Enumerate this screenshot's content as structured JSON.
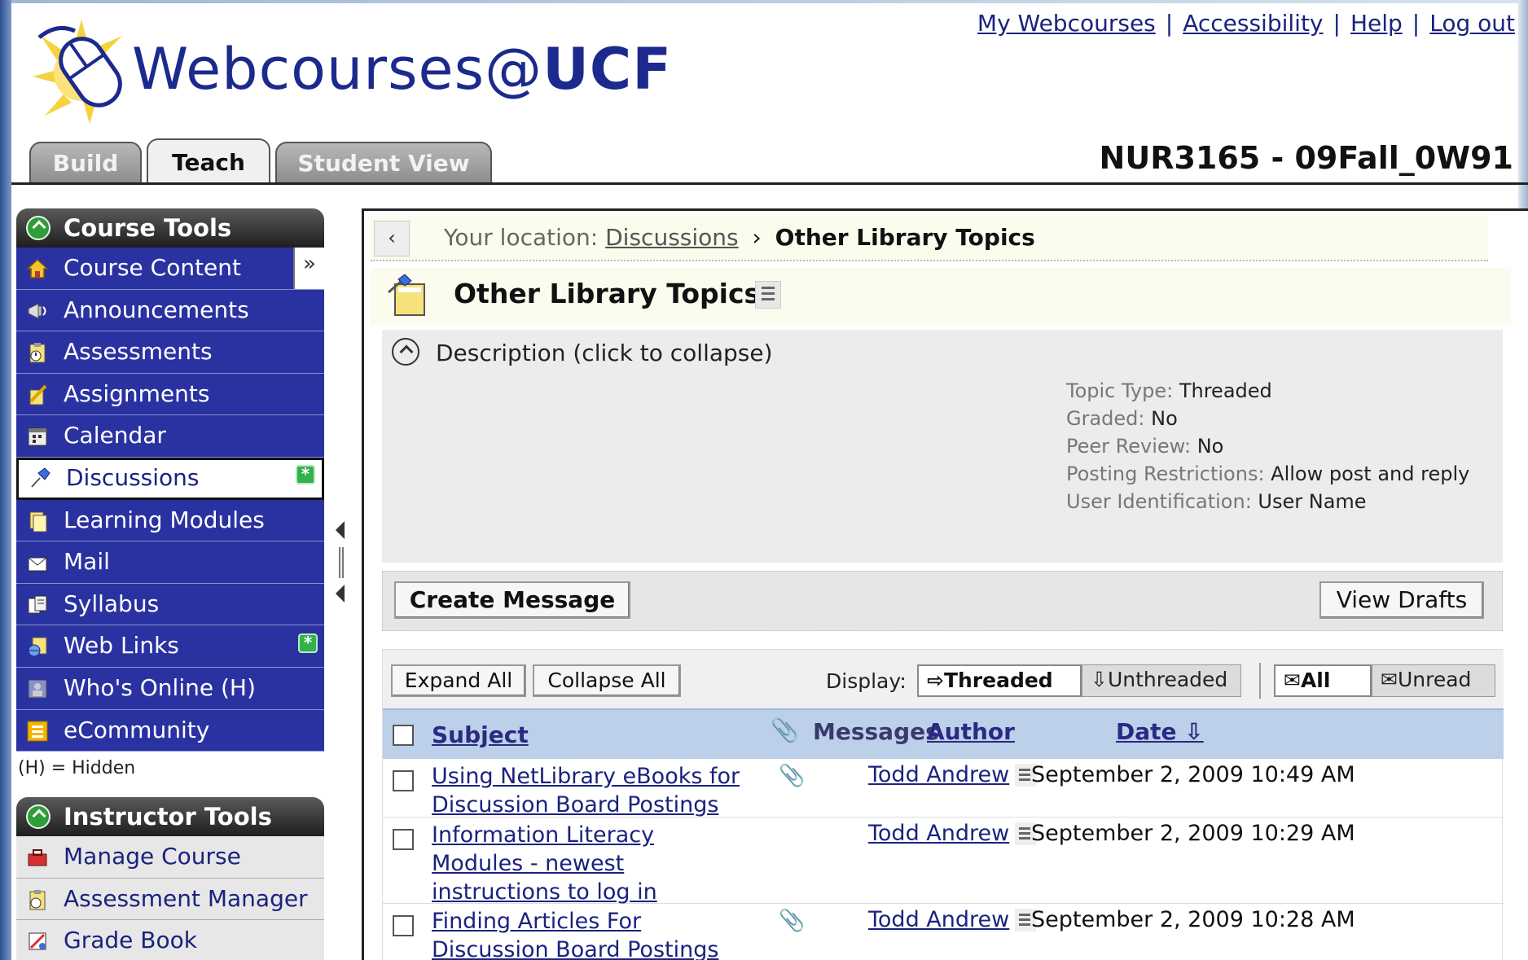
{
  "top_links": [
    "My Webcourses",
    "Accessibility",
    "Help",
    "Log out"
  ],
  "top_links_separator": "|",
  "logo": {
    "text_regular": "Webcourses@",
    "text_bold": "UCF"
  },
  "tabs": [
    {
      "label": "Build",
      "active": false
    },
    {
      "label": "Teach",
      "active": true
    },
    {
      "label": "Student View",
      "active": false
    }
  ],
  "course_id": "NUR3165 - 09Fall_0W91",
  "sidebar": {
    "course_tools_title": "Course Tools",
    "course_tools": [
      {
        "label": "Course Content",
        "icon": "home-icon"
      },
      {
        "label": "Announcements",
        "icon": "megaphone-icon"
      },
      {
        "label": "Assessments",
        "icon": "clipboard-icon"
      },
      {
        "label": "Assignments",
        "icon": "pencil-paper-icon"
      },
      {
        "label": "Calendar",
        "icon": "calendar-icon"
      },
      {
        "label": "Discussions",
        "icon": "pushpin-icon",
        "active": true
      },
      {
        "label": "Learning Modules",
        "icon": "modules-icon"
      },
      {
        "label": "Mail",
        "icon": "mail-icon"
      },
      {
        "label": "Syllabus",
        "icon": "syllabus-icon"
      },
      {
        "label": "Web Links",
        "icon": "globe-icon"
      },
      {
        "label": "Who's Online (H)",
        "icon": "person-icon"
      },
      {
        "label": "eCommunity",
        "icon": "ecommunity-icon"
      }
    ],
    "hidden_note": "(H) = Hidden",
    "badge_glyph": "*",
    "instructor_tools_title": "Instructor Tools",
    "instructor_tools": [
      {
        "label": "Manage Course",
        "icon": "toolbox-icon"
      },
      {
        "label": "Assessment Manager",
        "icon": "clipboard-icon"
      },
      {
        "label": "Grade Book",
        "icon": "gradebook-icon"
      }
    ]
  },
  "breadcrumb": {
    "back_glyph": "‹",
    "prefix": "Your location:",
    "parent": "Discussions",
    "separator": "›",
    "current": "Other Library Topics"
  },
  "page_title": "Other Library Topics",
  "description": {
    "toggle_label": "Description (click to collapse)",
    "meta": [
      {
        "key": "Topic Type:",
        "value": "Threaded"
      },
      {
        "key": "Graded:",
        "value": "No"
      },
      {
        "key": "Peer Review:",
        "value": "No"
      },
      {
        "key": "Posting Restrictions:",
        "value": "Allow post and reply"
      },
      {
        "key": "User Identification:",
        "value": "User Name"
      }
    ]
  },
  "actions": {
    "create_message": "Create Message",
    "view_drafts": "View Drafts"
  },
  "toolbar": {
    "expand_all": "Expand All",
    "collapse_all": "Collapse All",
    "display_label": "Display:",
    "threaded": "⇨Threaded",
    "unthreaded": "⇩Unthreaded",
    "all": "✉All",
    "unread": "✉Unread"
  },
  "table": {
    "headers": {
      "subject": "Subject",
      "messages": "Messages",
      "author": "Author",
      "date": "Date ⇩"
    },
    "attachment_glyph": "📎",
    "rows": [
      {
        "subject": "Using NetLibrary eBooks for Discussion Board Postings",
        "attachment": true,
        "author": "Todd Andrew",
        "date": "September 2, 2009 10:49 AM"
      },
      {
        "subject": "Information Literacy Modules - newest instructions to log in",
        "attachment": false,
        "author": "Todd Andrew",
        "date": "September 2, 2009 10:29 AM"
      },
      {
        "subject": "Finding Articles For Discussion Board Postings",
        "attachment": true,
        "author": "Todd Andrew",
        "date": "September 2, 2009 10:28 AM"
      }
    ]
  },
  "colors": {
    "nav_blue": "#2a32a2",
    "link_blue": "#1a237e",
    "header_blue": "#bcd0ea",
    "panel_dark": "#1e1e1e"
  }
}
